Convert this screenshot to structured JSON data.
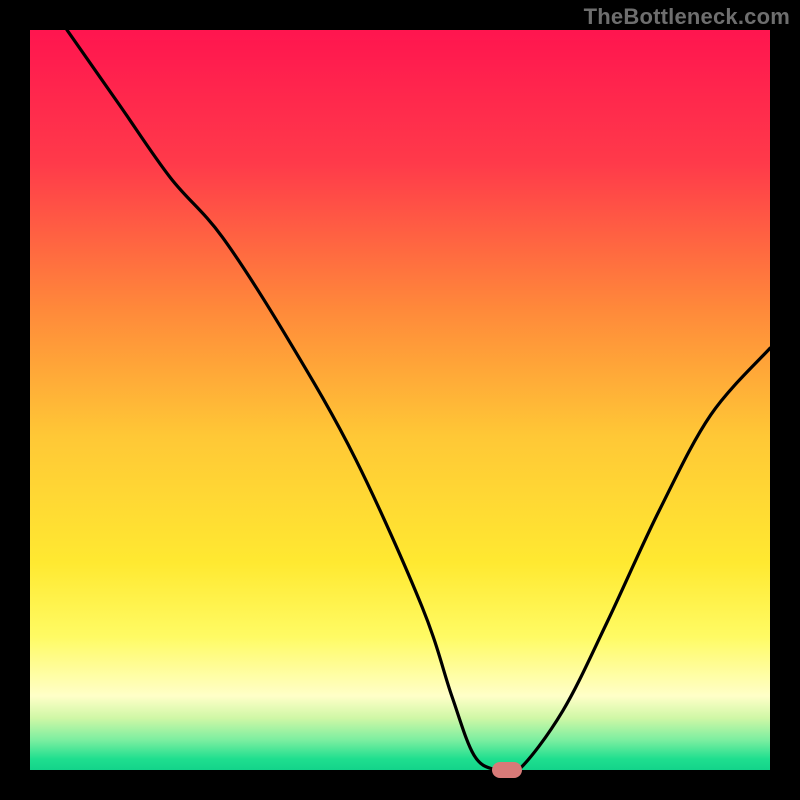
{
  "attribution": "TheBottleneck.com",
  "chart_data": {
    "type": "line",
    "title": "",
    "xlabel": "",
    "ylabel": "",
    "xlim": [
      0,
      100
    ],
    "ylim": [
      0,
      100
    ],
    "grid": false,
    "legend": false,
    "background_gradient": {
      "stops": [
        {
          "pos": 0.0,
          "color": "#ff154f"
        },
        {
          "pos": 0.18,
          "color": "#ff3a4a"
        },
        {
          "pos": 0.38,
          "color": "#ff8a3a"
        },
        {
          "pos": 0.55,
          "color": "#ffc836"
        },
        {
          "pos": 0.72,
          "color": "#ffe931"
        },
        {
          "pos": 0.82,
          "color": "#fffb64"
        },
        {
          "pos": 0.9,
          "color": "#ffffc8"
        },
        {
          "pos": 0.93,
          "color": "#cff7a6"
        },
        {
          "pos": 0.96,
          "color": "#7aeea0"
        },
        {
          "pos": 0.985,
          "color": "#1fdf8f"
        },
        {
          "pos": 1.0,
          "color": "#13d48a"
        }
      ]
    },
    "series": [
      {
        "name": "bottleneck-curve",
        "color": "#000000",
        "x": [
          5,
          12,
          19,
          26,
          35,
          44,
          53,
          57,
          60,
          63,
          66,
          72,
          78,
          85,
          92,
          100
        ],
        "values": [
          100,
          90,
          80,
          72,
          58,
          42,
          22,
          10,
          2,
          0,
          0,
          8,
          20,
          35,
          48,
          57
        ]
      }
    ],
    "marker": {
      "x": 64.5,
      "y": 0,
      "color": "#d87a78"
    }
  }
}
